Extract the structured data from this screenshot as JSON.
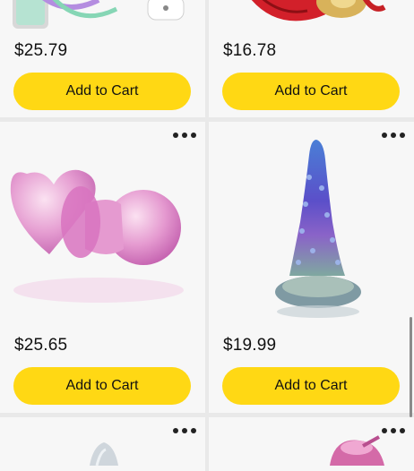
{
  "products": [
    {
      "price": "$25.79",
      "cta": "Add to Cart"
    },
    {
      "price": "$16.78",
      "cta": "Add to Cart"
    },
    {
      "price": "$25.65",
      "cta": "Add to Cart"
    },
    {
      "price": "$19.99",
      "cta": "Add to Cart"
    }
  ],
  "icons": {
    "more": "more-options-icon"
  },
  "colors": {
    "button": "#ffd814",
    "card": "#f7f7f7",
    "page": "#e9e9e9"
  }
}
